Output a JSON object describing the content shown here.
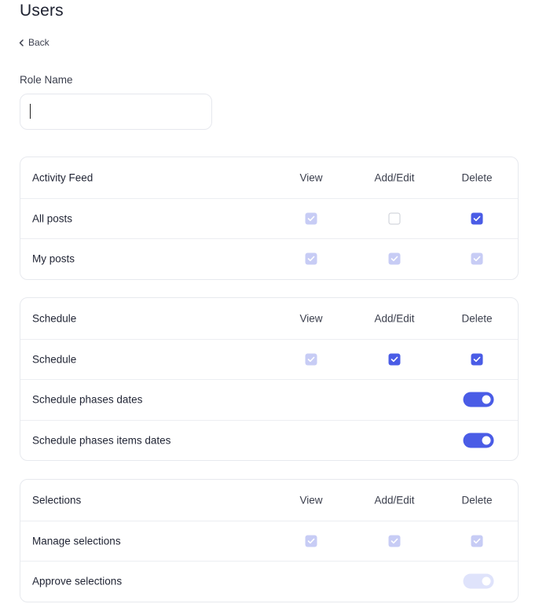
{
  "page": {
    "title": "Users"
  },
  "back": {
    "label": "Back"
  },
  "form": {
    "role_name_label": "Role Name",
    "role_name_value": "",
    "role_name_placeholder": ""
  },
  "colors": {
    "accent": "#4a5ce6",
    "accent_disabled": "#c7ccf5",
    "border": "#e7e9ee"
  },
  "columns": {
    "view": "View",
    "add_edit": "Add/Edit",
    "delete": "Delete"
  },
  "sections": [
    {
      "title": "Activity Feed",
      "rows": [
        {
          "label": "All posts",
          "view": "checked-disabled",
          "add_edit": "unchecked",
          "delete": "checked"
        },
        {
          "label": "My posts",
          "view": "checked-disabled",
          "add_edit": "checked-disabled",
          "delete": "checked-disabled"
        }
      ]
    },
    {
      "title": "Schedule",
      "rows": [
        {
          "label": "Schedule",
          "view": "checked-disabled",
          "add_edit": "checked",
          "delete": "checked"
        },
        {
          "label": "Schedule phases dates",
          "toggle": "on"
        },
        {
          "label": "Schedule phases items dates",
          "toggle": "on"
        }
      ]
    },
    {
      "title": "Selections",
      "rows": [
        {
          "label": "Manage selections",
          "view": "checked-disabled",
          "add_edit": "checked-disabled",
          "delete": "checked-disabled"
        },
        {
          "label": "Approve selections",
          "toggle": "on-disabled"
        }
      ]
    }
  ]
}
